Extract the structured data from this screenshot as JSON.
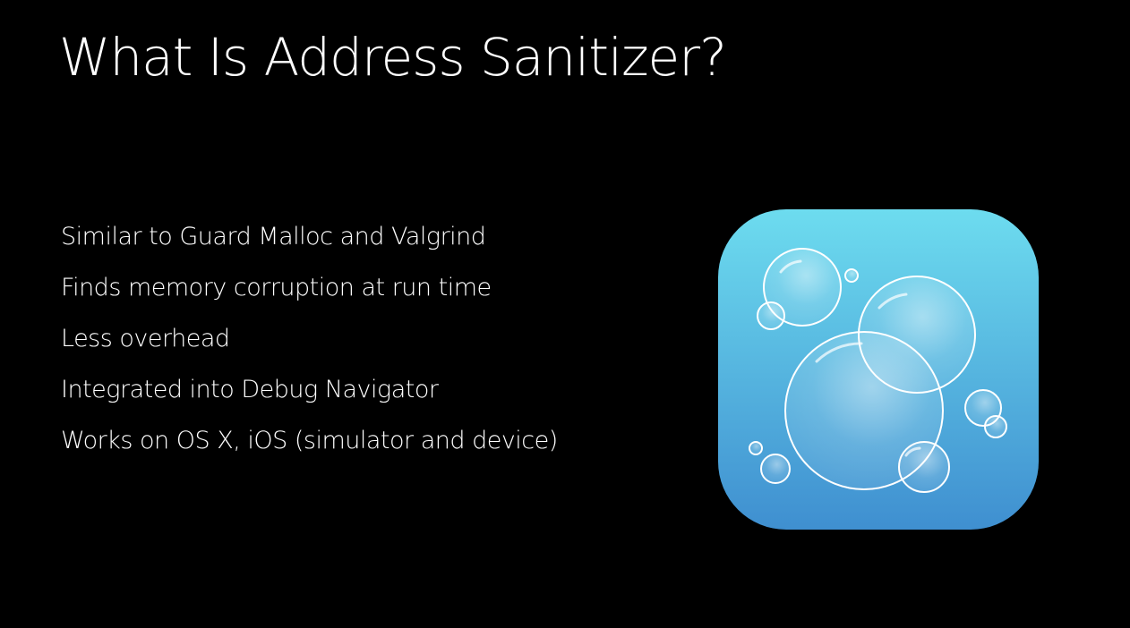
{
  "slide": {
    "title": "What Is Address Sanitizer?",
    "bullets": [
      "Similar to Guard Malloc and Valgrind",
      "Finds memory corruption at run time",
      "Less overhead",
      "Integrated into Debug Navigator",
      "Works on OS X, iOS (simulator and device)"
    ]
  },
  "icon": {
    "name": "address-sanitizer-bubbles-icon",
    "gradient_top": "#6ddcef",
    "gradient_bottom": "#3f8fd0"
  },
  "colors": {
    "background": "#000000",
    "text": "#ffffff"
  }
}
